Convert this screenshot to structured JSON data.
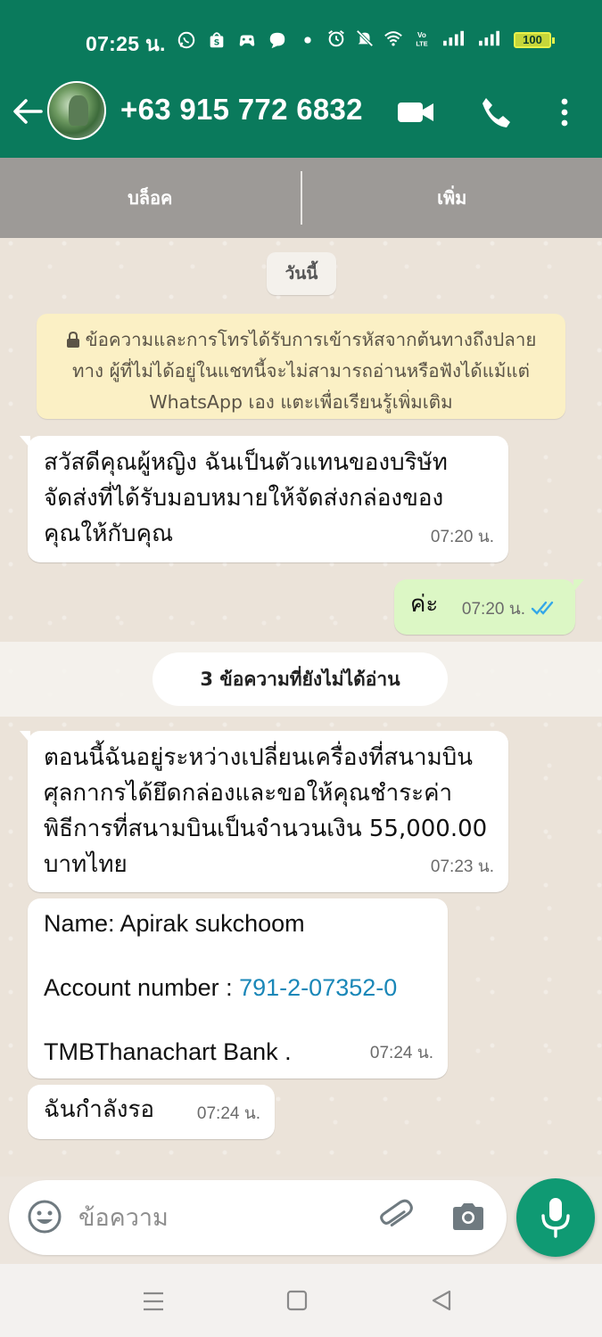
{
  "status_bar": {
    "time": "07:25 น.",
    "battery": "100",
    "volte": "Vo LTE",
    "icons": [
      "whatsapp-icon",
      "shopee-icon",
      "game-icon",
      "chat-icon",
      "dot-icon",
      "alarm-icon",
      "mute-icon",
      "wifi-icon",
      "signal-icon",
      "signal-icon",
      "battery-icon"
    ]
  },
  "header": {
    "contact_name": "+63 915 772 6832",
    "brand_color": "#0a7a5c"
  },
  "actions": {
    "block_label": "บล็อค",
    "add_label": "เพิ่ม"
  },
  "chat": {
    "date_label": "วันนี้",
    "encryption_notice": "ข้อความและการโทรได้รับการเข้ารหัสจากต้นทางถึงปลายทาง ผู้ที่ไม่ได้อยู่ในแชทนี้จะไม่สามารถอ่านหรือฟังได้แม้แต่ WhatsApp เอง แตะเพื่อเรียนรู้เพิ่มเติม",
    "unread_label": "3 ข้อความที่ยังไม่ได้อ่าน",
    "messages": [
      {
        "direction": "in",
        "text": "สวัสดีคุณผู้หญิง ฉันเป็นตัวแทนของบริษัทจัดส่งที่ได้รับมอบหมายให้จัดส่งกล่องของคุณให้กับคุณ",
        "time": "07:20 น."
      },
      {
        "direction": "out",
        "text": "ค่ะ",
        "time": "07:20 น.",
        "status": "read"
      },
      {
        "direction": "in",
        "text": "ตอนนี้ฉันอยู่ระหว่างเปลี่ยนเครื่องที่สนามบิน ศุลกากรได้ยึดกล่องและขอให้คุณชำระค่าพิธีการที่สนามบินเป็นจำนวนเงิน 55,000.00 บาทไทย",
        "time": "07:23 น."
      },
      {
        "direction": "in",
        "name_line": "Name: Apirak sukchoom",
        "account_label": "Account number : ",
        "account_number": "791-2-07352-0",
        "bank_line": "TMBThanachart Bank .",
        "time": "07:24 น."
      },
      {
        "direction": "in",
        "text": "ฉันกำลังรอ",
        "time": "07:24 น."
      }
    ]
  },
  "composer": {
    "placeholder": "ข้อความ"
  }
}
